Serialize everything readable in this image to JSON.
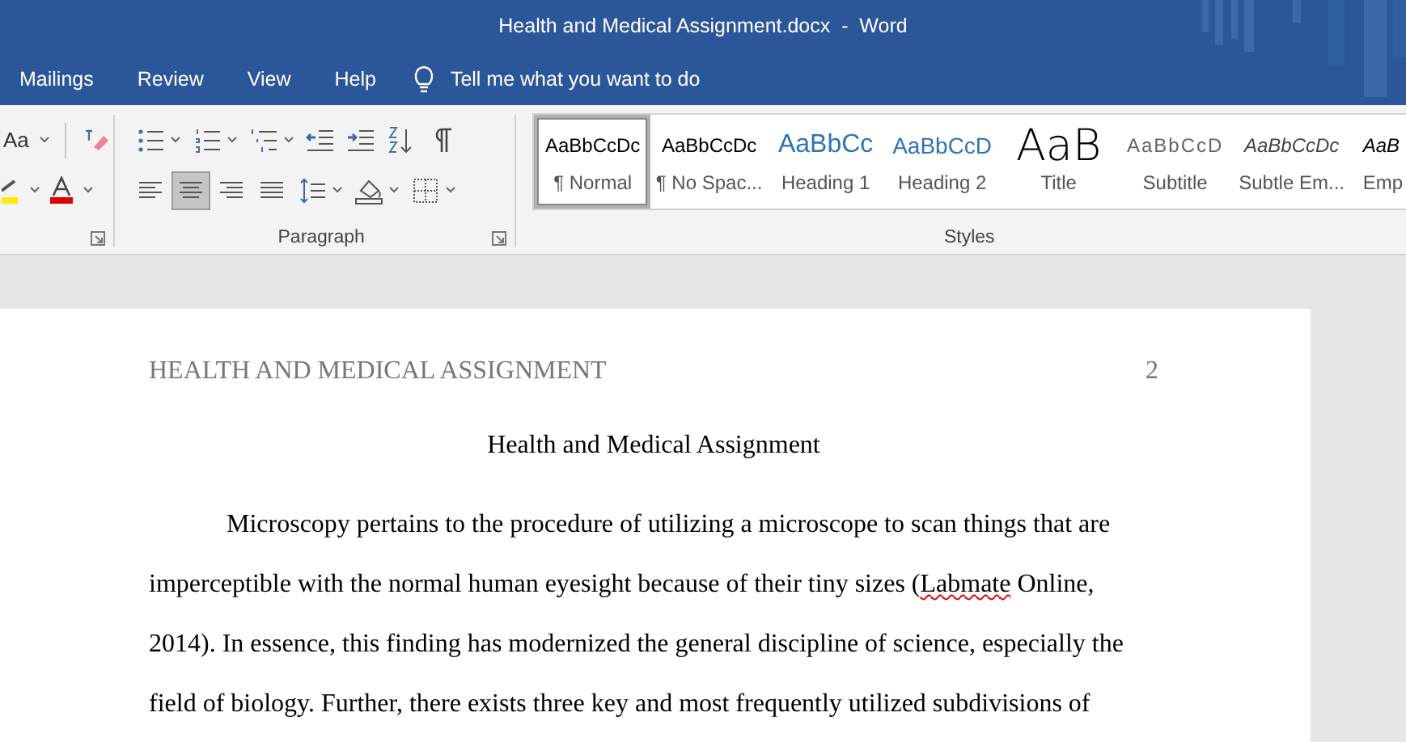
{
  "window": {
    "title": "Health and Medical Assignment.docx  -  Word"
  },
  "tabs": [
    {
      "label": "Mailings"
    },
    {
      "label": "Review"
    },
    {
      "label": "View"
    },
    {
      "label": "Help"
    }
  ],
  "tell_me": {
    "placeholder": "Tell me what you want to do"
  },
  "font_group": {
    "change_case": "Aa"
  },
  "paragraph_group": {
    "label": "Paragraph",
    "row1": [
      {
        "kind": "bullets",
        "dropdown": true,
        "selected": false
      },
      {
        "kind": "numbering",
        "dropdown": true,
        "selected": false
      },
      {
        "kind": "multilevel",
        "dropdown": true,
        "selected": false
      },
      {
        "kind": "outdent",
        "dropdown": false,
        "selected": false
      },
      {
        "kind": "indent",
        "dropdown": false,
        "selected": false
      },
      {
        "kind": "sort",
        "dropdown": false,
        "selected": false
      },
      {
        "kind": "pilcrow",
        "dropdown": false,
        "selected": false
      }
    ],
    "row2": [
      {
        "kind": "align-left",
        "dropdown": false,
        "selected": false
      },
      {
        "kind": "align-center",
        "dropdown": false,
        "selected": true
      },
      {
        "kind": "align-right",
        "dropdown": false,
        "selected": false
      },
      {
        "kind": "justify",
        "dropdown": false,
        "selected": false
      },
      {
        "kind": "line-spacing",
        "dropdown": true,
        "selected": false
      },
      {
        "kind": "shading",
        "dropdown": true,
        "selected": false
      },
      {
        "kind": "borders",
        "dropdown": true,
        "selected": false
      }
    ]
  },
  "styles_group": {
    "label": "Styles",
    "styles": [
      {
        "kind": "normal",
        "preview": "AaBbCcDc",
        "name": "¶ Normal",
        "selected": true
      },
      {
        "kind": "normal",
        "preview": "AaBbCcDc",
        "name": "¶ No Spac...",
        "selected": false
      },
      {
        "kind": "heading1",
        "preview": "AaBbCc",
        "name": "Heading 1",
        "selected": false
      },
      {
        "kind": "heading2",
        "preview": "AaBbCcD",
        "name": "Heading 2",
        "selected": false
      },
      {
        "kind": "title",
        "preview": "AaB",
        "name": "Title",
        "selected": false
      },
      {
        "kind": "subtitle",
        "preview": "AaBbCcD",
        "name": "Subtitle",
        "selected": false
      },
      {
        "kind": "subtle-emphasis",
        "preview": "AaBbCcDc",
        "name": "Subtle Em...",
        "selected": false
      },
      {
        "kind": "emphasis",
        "preview": "AaB",
        "name": "Emp",
        "selected": false
      }
    ]
  },
  "document": {
    "header": "HEALTH AND MEDICAL ASSIGNMENT",
    "page_number": "2",
    "title": "Health and Medical Assignment",
    "paragraph": [
      {
        "text": "Microscopy pertains to the procedure of utilizing a microscope to scan things that are imperceptible with the normal human eyesight because of their tiny sizes (",
        "misspelled": false
      },
      {
        "text": "Labmate",
        "misspelled": true
      },
      {
        "text": " Online, 2014). In essence, this finding has modernized the general discipline of science, especially the field of biology. Further, there exists three key and most frequently utilized subdivisions of",
        "misspelled": false
      }
    ]
  }
}
